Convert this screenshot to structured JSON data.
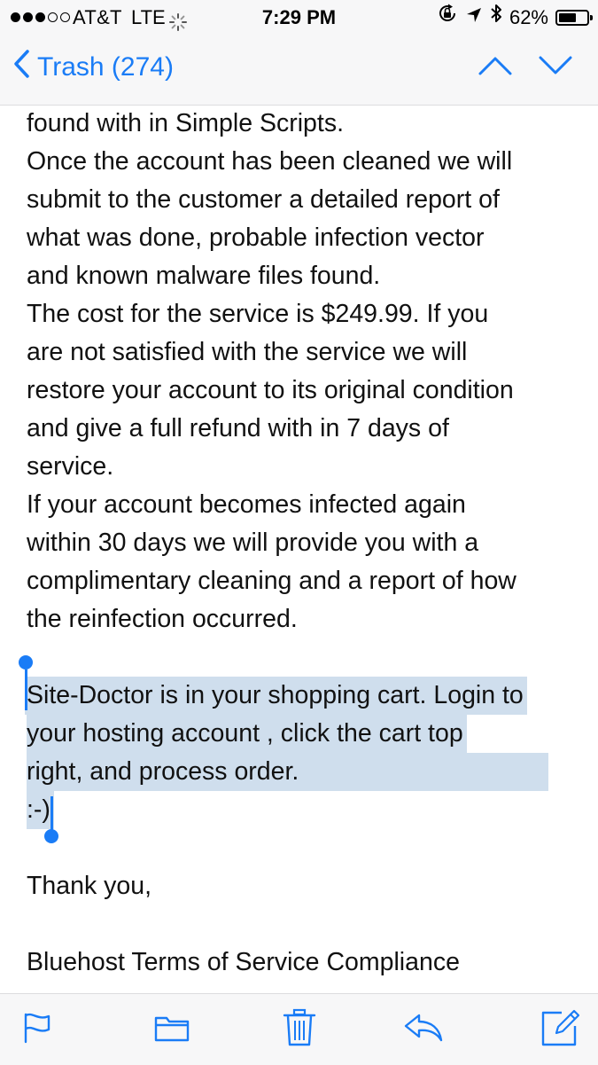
{
  "status_bar": {
    "carrier": "AT&T",
    "network": "LTE",
    "time": "7:29 PM",
    "battery": "62%",
    "battery_level": 0.62,
    "signal_bars_filled": 3,
    "signal_bars_total": 5
  },
  "nav": {
    "back_label": "Trash (274)",
    "up_icon": "chevron-up-icon",
    "down_icon": "chevron-down-icon"
  },
  "email": {
    "lines_before": [
      "found with in Simple Scripts.",
      "Once the account has been cleaned we will",
      "submit to the customer a detailed report of",
      "what was done, probable infection vector",
      "and known malware files found.",
      "The cost for the service is $249.99. If you",
      "are not satisfied with the service we will",
      "restore your account to its original condition",
      "and give a full refund with in 7 days of",
      "service.",
      "If your account becomes infected again",
      "within 30 days we will provide you with a",
      "complimentary cleaning and a report of how",
      "the reinfection occurred."
    ],
    "selected_lines": [
      "Site-Doctor is in your shopping cart. Login to",
      "your hosting account , click the cart top",
      "right, and process order.",
      ":-)"
    ],
    "closing": "Thank you,",
    "signature": "Bluehost Terms of Service Compliance"
  },
  "toolbar": {
    "items": [
      "flag-icon",
      "folder-icon",
      "trash-icon",
      "reply-icon",
      "compose-icon"
    ]
  },
  "colors": {
    "accent": "#1a7cf6",
    "selection": "#cfdeed",
    "bar_background": "#f7f7f8"
  }
}
